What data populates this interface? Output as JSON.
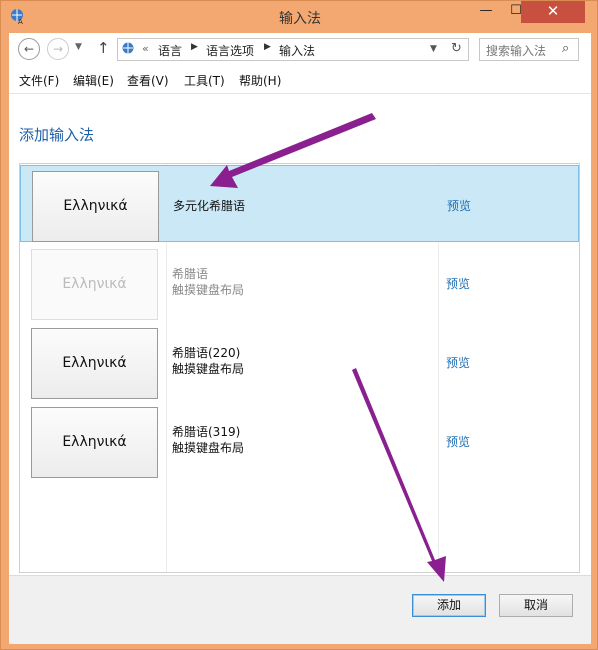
{
  "window": {
    "title": "输入法",
    "minimize": "—",
    "maximize": "☐",
    "close": "✕"
  },
  "nav": {
    "back": "←",
    "forward": "→",
    "history": "▼",
    "up": "↑"
  },
  "address": {
    "prefix": "«",
    "crumbs": [
      "语言",
      "语言选项",
      "输入法"
    ],
    "separator": "▶",
    "dropdown": "▼",
    "refresh": "↻"
  },
  "search": {
    "placeholder": "搜索输入法",
    "icon": "⌕"
  },
  "menu": [
    "文件(F)",
    "编辑(E)",
    "查看(V)",
    "工具(T)",
    "帮助(H)"
  ],
  "heading": "添加输入法",
  "layouts": [
    {
      "keyboard": "Ελληνικά",
      "line1": "多元化希腊语",
      "line2": "",
      "preview": "预览",
      "selected": true,
      "disabled": false
    },
    {
      "keyboard": "Ελληνικά",
      "line1": "希腊语",
      "line2": "触摸键盘布局",
      "preview": "预览",
      "selected": false,
      "disabled": true
    },
    {
      "keyboard": "Ελληνικά",
      "line1": "希腊语(220)",
      "line2": "触摸键盘布局",
      "preview": "预览",
      "selected": false,
      "disabled": false
    },
    {
      "keyboard": "Ελληνικά",
      "line1": "希腊语(319)",
      "line2": "触摸键盘布局",
      "preview": "预览",
      "selected": false,
      "disabled": false
    }
  ],
  "buttons": {
    "add": "添加",
    "cancel": "取消"
  },
  "colors": {
    "window_frame": "#f3a872",
    "accent_link": "#1f6fb4",
    "selection": "#cbe8f6",
    "annotation_arrow": "#8a1f8f"
  }
}
